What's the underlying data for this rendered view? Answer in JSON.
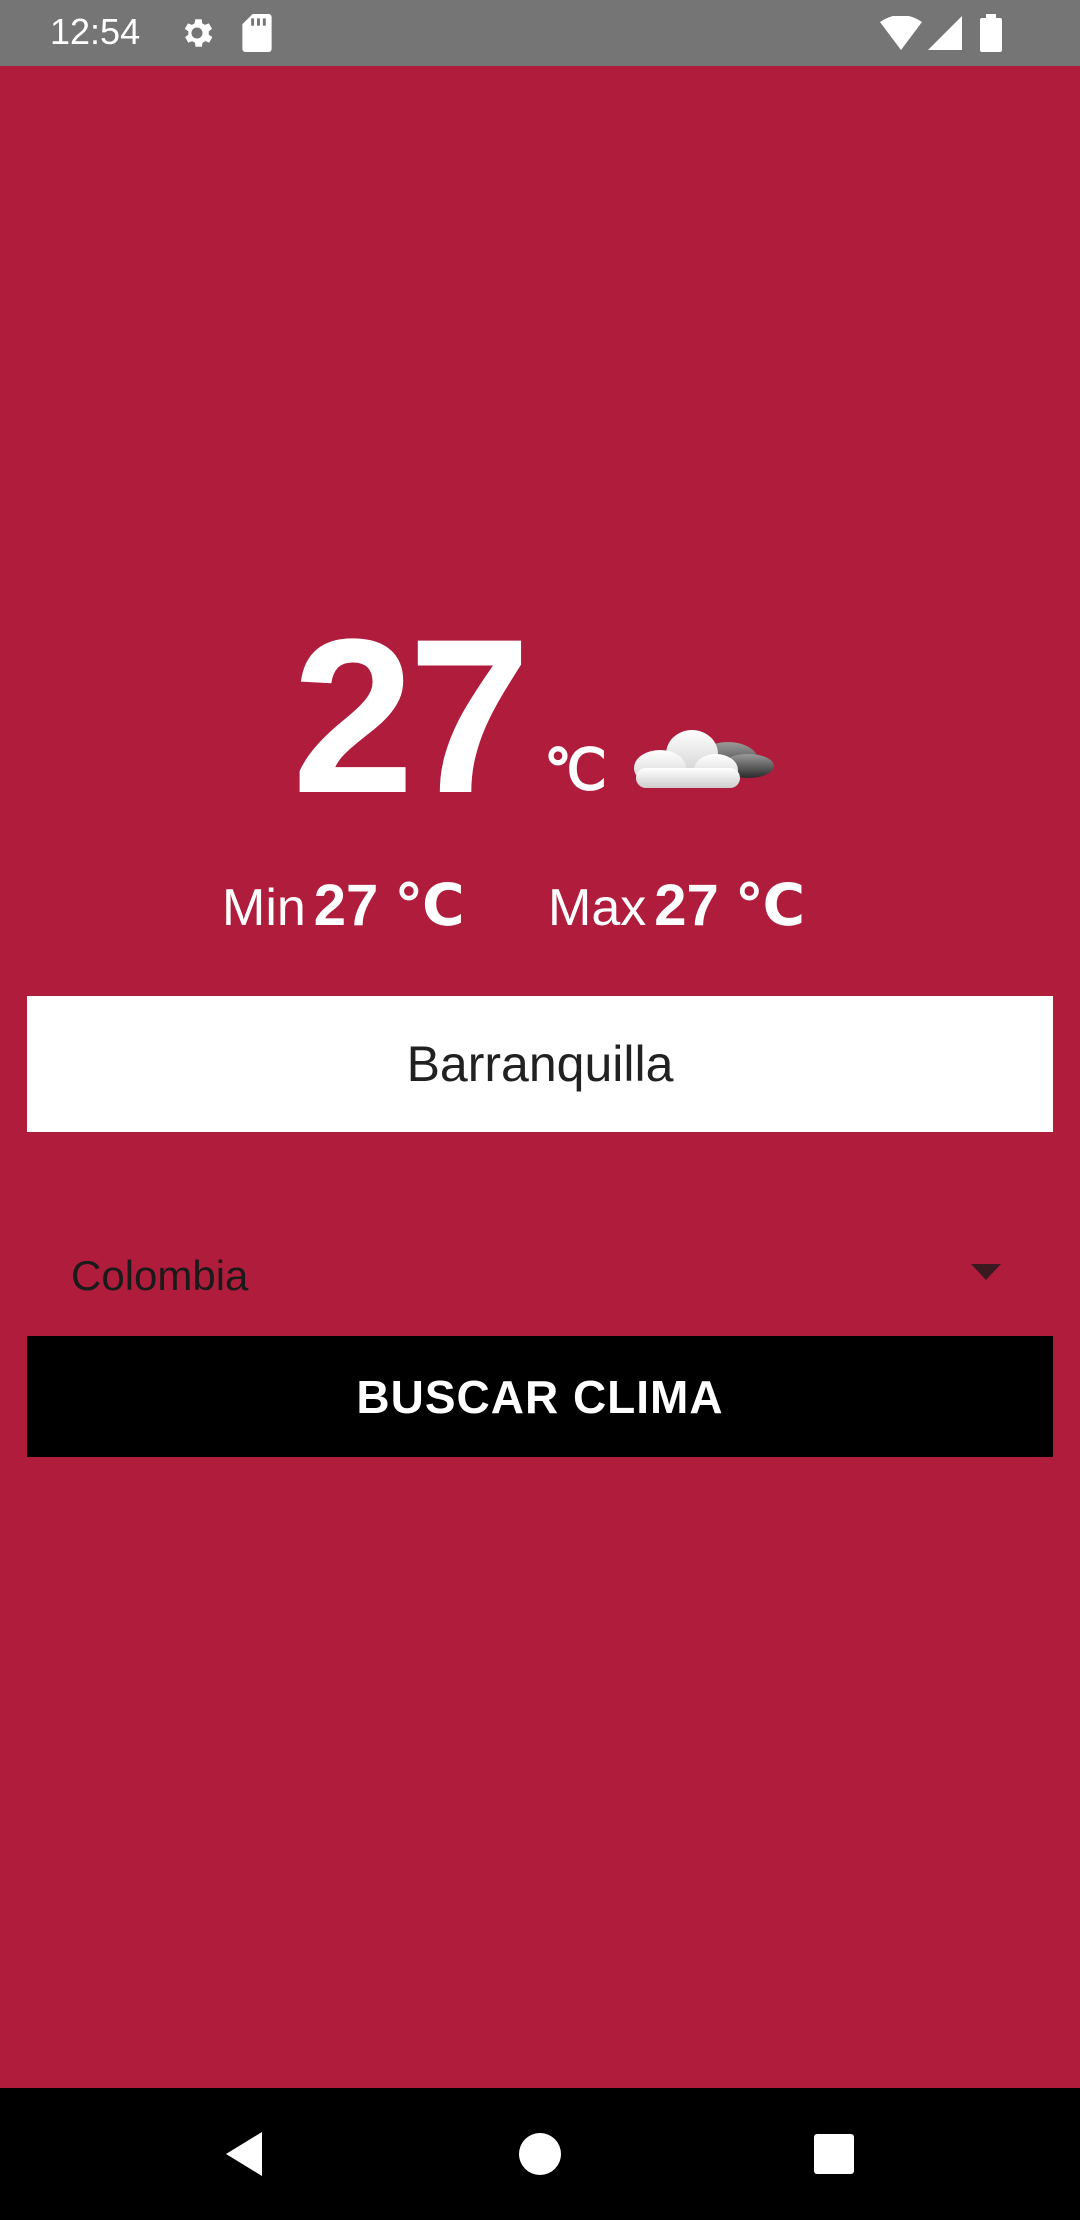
{
  "status_bar": {
    "time": "12:54",
    "icons": [
      "gear-icon",
      "sd-card-icon",
      "wifi-icon",
      "signal-icon",
      "battery-icon"
    ]
  },
  "weather": {
    "temperature": "27",
    "unit": "℃",
    "condition_icon": "partly-cloudy-icon",
    "min_label": "Min",
    "min_value": "27 ℃",
    "max_label": "Max",
    "max_value": "27 ℃"
  },
  "form": {
    "city_value": "Barranquilla",
    "country_value": "Colombia",
    "search_label": "BUSCAR CLIMA"
  },
  "nav_bar": {
    "icons": [
      "back-icon",
      "home-icon",
      "recents-icon"
    ]
  },
  "colors": {
    "background": "#b01d3c",
    "status_bar": "#757575",
    "button": "#000000",
    "text_light": "#ffffff"
  }
}
